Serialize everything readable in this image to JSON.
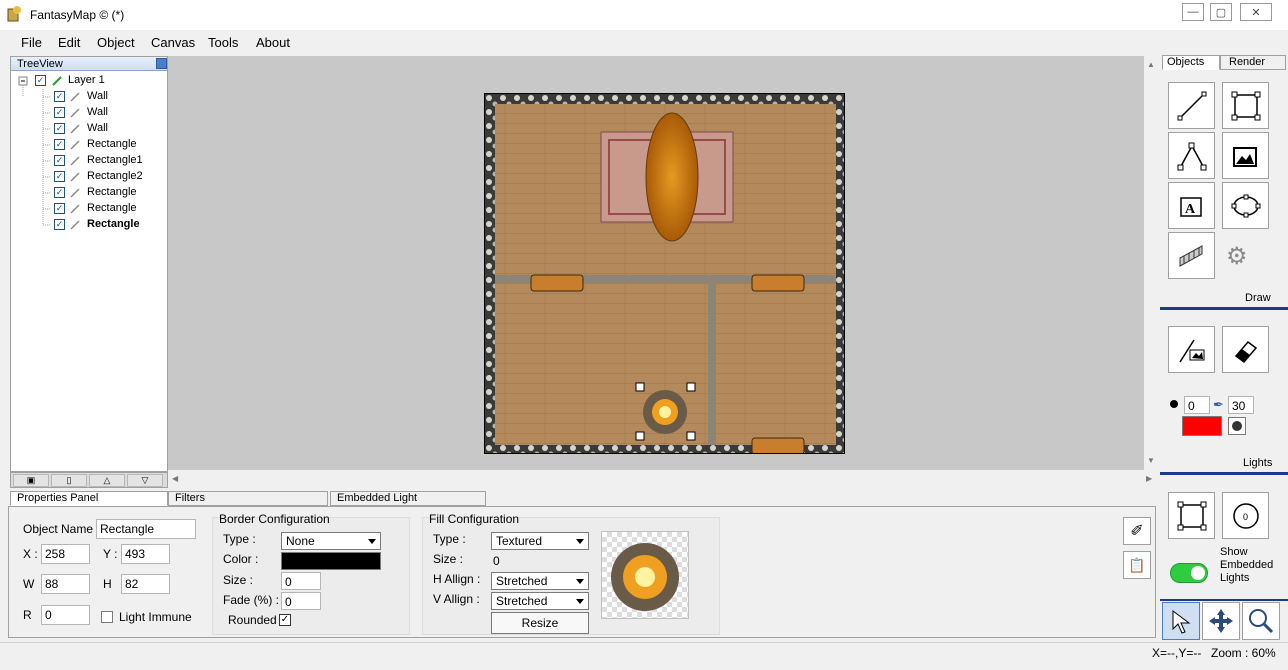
{
  "window": {
    "title": "FantasyMap © (*)",
    "minimize_icon": "minimize-icon",
    "maximize_icon": "maximize-icon",
    "close_icon": "close-icon"
  },
  "menu": [
    "File",
    "Edit",
    "Object",
    "Canvas",
    "Tools",
    "About"
  ],
  "treeview": {
    "title": "TreeView",
    "layer_label": "Layer 1",
    "items": [
      "Wall",
      "Wall",
      "Wall",
      "Rectangle",
      "Rectangle1",
      "Rectangle2",
      "Rectangle",
      "Rectangle",
      "Rectangle"
    ]
  },
  "right_tabs": {
    "objects": "Objects",
    "render": "Render"
  },
  "right_sections": {
    "draw": "Draw",
    "lights": "Lights",
    "show_embedded_lights": "Show Embedded Lights"
  },
  "brush": {
    "min_value": "0",
    "max_value": "30",
    "color": "#ff0000"
  },
  "bottom_tabs": [
    "Properties Panel",
    "Filters",
    "Embedded Light"
  ],
  "properties": {
    "object_name_label": "Object Name",
    "object_name": "Rectangle",
    "x_label": "X :",
    "x": "258",
    "y_label": "Y :",
    "y": "493",
    "w_label": "W",
    "w": "88",
    "h_label": "H",
    "h": "82",
    "r_label": "R",
    "r": "0",
    "light_immune_label": "Light Immune"
  },
  "border": {
    "title": "Border Configuration",
    "type_label": "Type :",
    "type_value": "None",
    "color_label": "Color :",
    "color_value": "#000000",
    "size_label": "Size :",
    "size_value": "0",
    "fade_label": "Fade (%) :",
    "fade_value": "0",
    "rounded_label": "Rounded"
  },
  "fill": {
    "title": "Fill Configuration",
    "type_label": "Type :",
    "type_value": "Textured",
    "size_label": "Size :",
    "size_value": "0",
    "h_align_label": "H Allign :",
    "h_align_value": "Stretched",
    "v_align_label": "V Allign :",
    "v_align_value": "Stretched",
    "resize_label": "Resize"
  },
  "status": {
    "coords": "X=--,Y=--",
    "zoom": "Zoom : 60%"
  },
  "colors": {
    "accent_blue": "#1b3a8a",
    "toggle_green": "#2ecc40",
    "wood": "#b08456"
  }
}
